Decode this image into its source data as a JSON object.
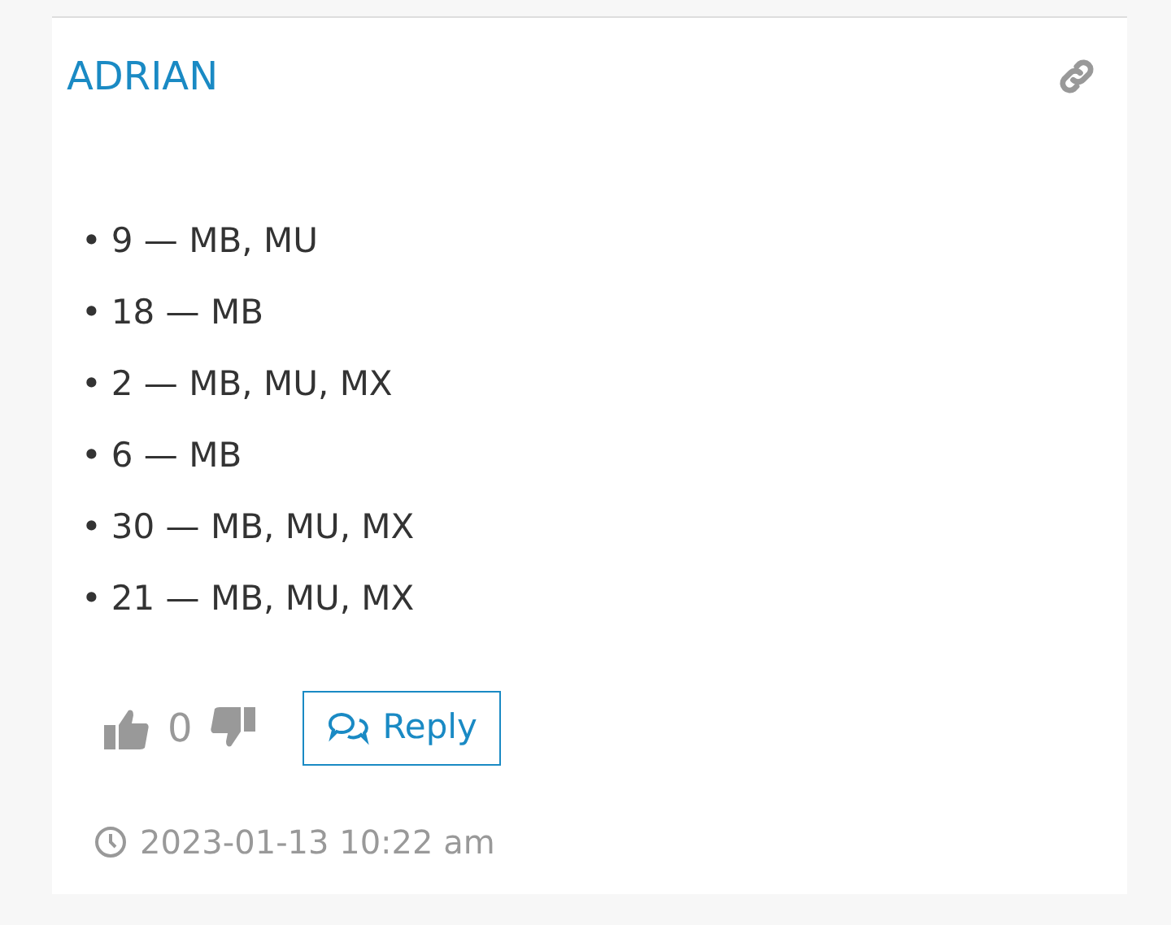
{
  "comment": {
    "author": "ADRIAN",
    "bullet": "•",
    "lines": [
      "9 — MB, MU",
      "18 — MB",
      "2 — MB, MU, MX",
      "6 — MB",
      "30 — MB, MU, MX",
      "21 — MB, MU, MX"
    ],
    "votes": "0",
    "reply_label": "Reply",
    "timestamp": "2023-01-13 10:22 am"
  }
}
